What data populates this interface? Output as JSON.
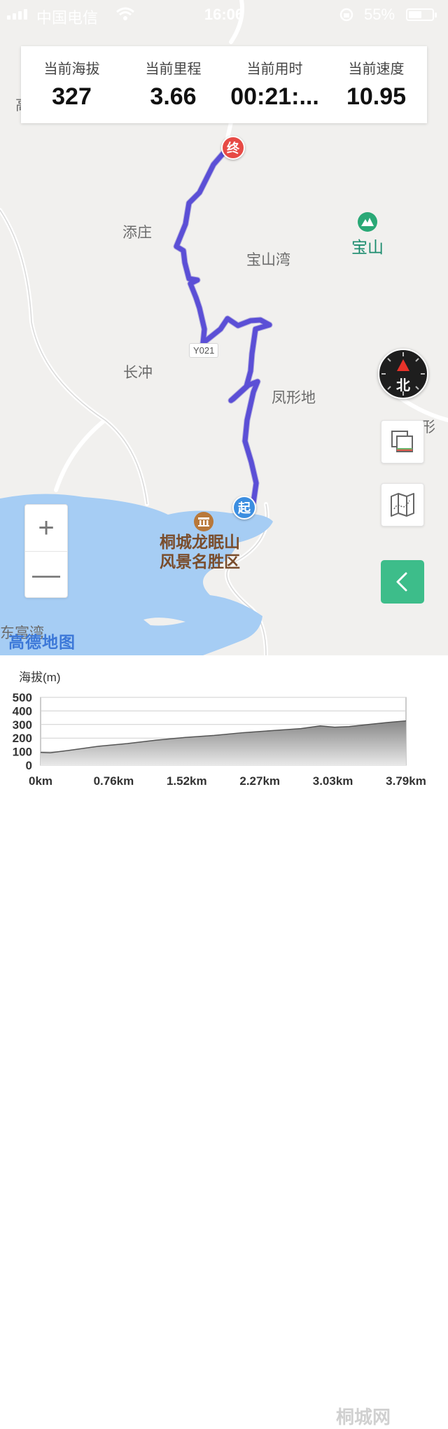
{
  "status_bar": {
    "carrier": "中国电信",
    "time": "16:06",
    "battery_percent": "55%",
    "battery_level": 0.55
  },
  "stats": [
    {
      "label": "当前海拔",
      "value": "327"
    },
    {
      "label": "当前里程",
      "value": "3.66"
    },
    {
      "label": "当前用时",
      "value": "00:21:..."
    },
    {
      "label": "当前速度",
      "value": "10.95"
    }
  ],
  "map": {
    "places": {
      "tianzhuang": "添庄",
      "baoshanwan": "宝山湾",
      "changchong": "长冲",
      "fengxingdi": "凤形地",
      "baoshan": "宝山",
      "scenic_line1": "桐城龙眠山",
      "scenic_line2": "风景名胜区",
      "edge_right": "凤形村",
      "edge_left_bottom": "东富湾",
      "edge_left_top": "高"
    },
    "road_tag": "Y021",
    "start_marker": "起",
    "end_marker": "终",
    "compass_label": "北",
    "provider_logo": "高德地图",
    "route_color": "#5b4fd6"
  },
  "controls": {
    "zoom_in": "+",
    "zoom_out": "—"
  },
  "chart_data": {
    "type": "area",
    "title": "海拔(m)",
    "y_ticks": [
      "500",
      "400",
      "300",
      "200",
      "100",
      "0"
    ],
    "x_ticks": [
      "0km",
      "0.76km",
      "1.52km",
      "2.27km",
      "3.03km",
      "3.79km"
    ],
    "ylim": [
      0,
      500
    ],
    "xlim": [
      0,
      3.79
    ],
    "grid": true,
    "x": [
      0,
      0.1,
      0.3,
      0.6,
      0.9,
      1.2,
      1.5,
      1.8,
      2.1,
      2.4,
      2.7,
      2.9,
      3.05,
      3.2,
      3.4,
      3.6,
      3.79
    ],
    "y": [
      95,
      92,
      110,
      140,
      160,
      185,
      205,
      220,
      240,
      255,
      270,
      290,
      280,
      285,
      300,
      315,
      327
    ]
  },
  "watermark": "桐城网"
}
